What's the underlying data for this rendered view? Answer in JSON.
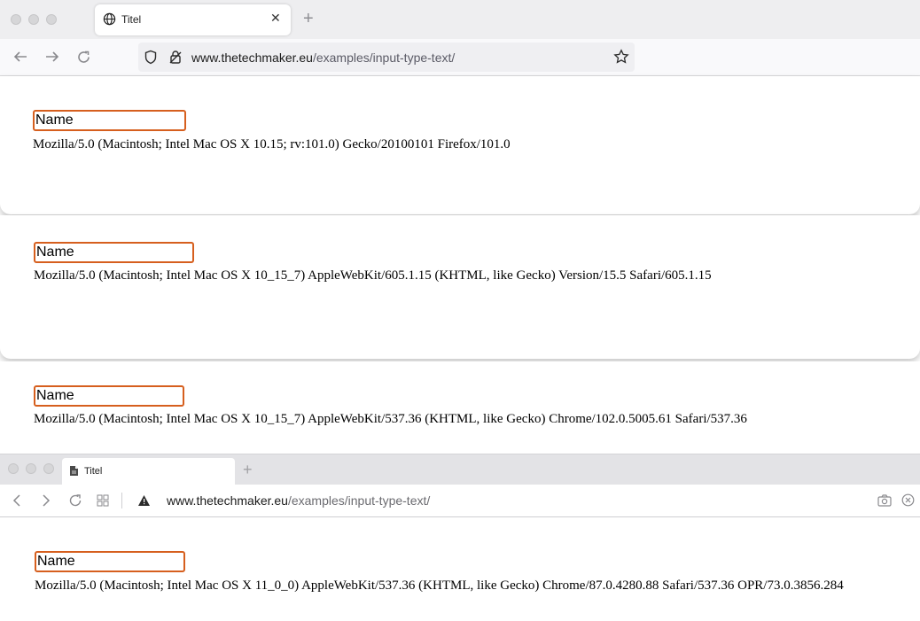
{
  "firefox": {
    "tab_title": "Titel",
    "url_host": "www.thetechmaker.eu",
    "url_path": "/examples/input-type-text/",
    "input_value": "Name",
    "user_agent": "Mozilla/5.0 (Macintosh; Intel Mac OS X 10.15; rv:101.0) Gecko/20100101 Firefox/101.0"
  },
  "safari": {
    "input_value": "Name",
    "user_agent": "Mozilla/5.0 (Macintosh; Intel Mac OS X 10_15_7) AppleWebKit/605.1.15 (KHTML, like Gecko) Version/15.5 Safari/605.1.15"
  },
  "chrome": {
    "input_value": "Name",
    "user_agent": "Mozilla/5.0 (Macintosh; Intel Mac OS X 10_15_7) AppleWebKit/537.36 (KHTML, like Gecko) Chrome/102.0.5005.61 Safari/537.36"
  },
  "opera": {
    "tab_title": "Titel",
    "url_host": "www.thetechmaker.eu",
    "url_path": "/examples/input-type-text/",
    "input_value": "Name",
    "user_agent": "Mozilla/5.0 (Macintosh; Intel Mac OS X 11_0_0) AppleWebKit/537.36 (KHTML, like Gecko) Chrome/87.0.4280.88 Safari/537.36 OPR/73.0.3856.284"
  },
  "icons": {
    "globe": "globe-icon",
    "close": "close-icon",
    "back": "arrow-left-icon",
    "forward": "arrow-right-icon",
    "reload": "reload-icon",
    "shield": "shield-icon",
    "lock": "lock-icon",
    "star": "star-icon",
    "page": "page-icon",
    "grid": "grid-icon",
    "warning": "warning-icon",
    "camera": "camera-icon"
  },
  "colors": {
    "input_border": "#d65f1e",
    "firefox_titlebar": "#eeeef0",
    "opera_titlebar": "#e3e3e6"
  }
}
